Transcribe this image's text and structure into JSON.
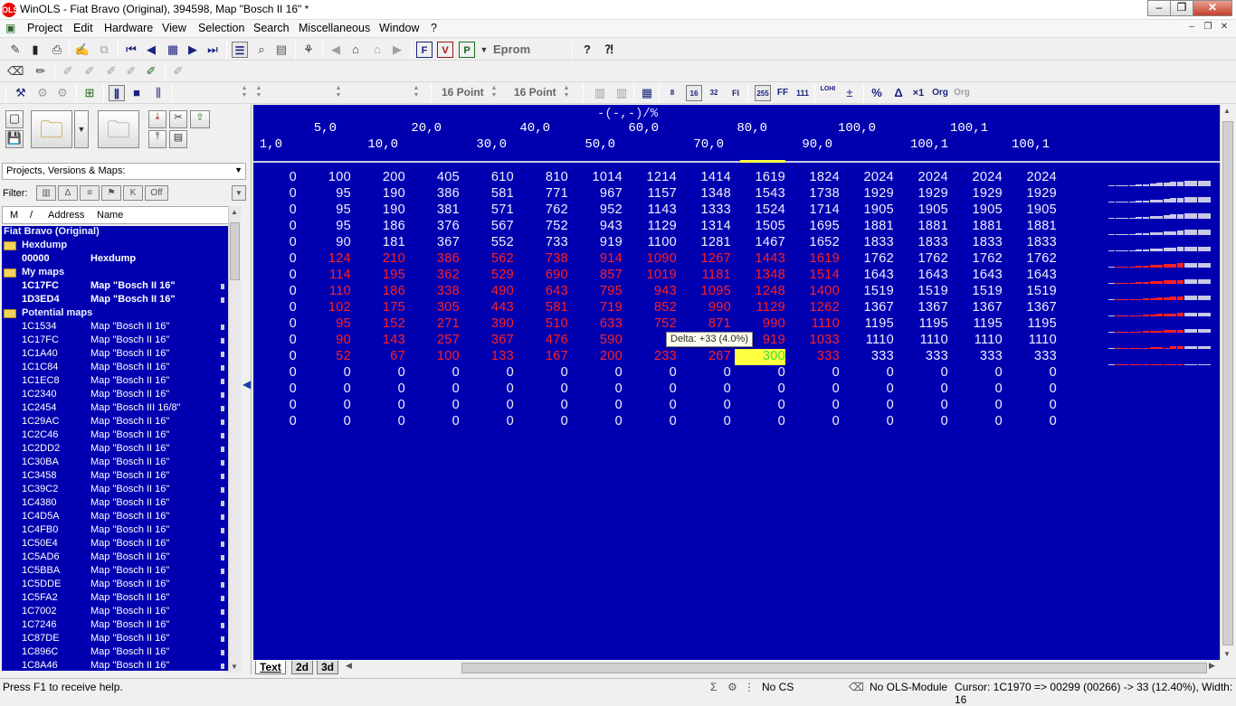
{
  "window": {
    "title": "WinOLS - Fiat Bravo (Original), 394598, Map \"Bosch II 16\" *",
    "app_icon": "winols-logo-icon"
  },
  "menu": [
    "Project",
    "Edit",
    "Hardware",
    "View",
    "Selection",
    "Search",
    "Miscellaneous",
    "Window",
    "?"
  ],
  "toolbar": {
    "eprom_label": "Eprom",
    "point_a": "16 Point",
    "point_b": "16 Point",
    "btn_255": "255",
    "btn_ff": "FF",
    "btn_111": "111",
    "btn_8": "8",
    "btn_16": "16",
    "btn_32": "32",
    "btn_fl": "Fl",
    "btn_lohi": "LOHI",
    "btn_org": "Org",
    "btn_org2": "Org",
    "btn_x1": "×1",
    "btn_pct": "%",
    "btn_delta": "Δ"
  },
  "left": {
    "combo_label": "Projects, Versions & Maps:",
    "filter_label": "Filter:",
    "filter_off": "Off",
    "col_m": "M",
    "col_slash": "/",
    "col_address": "Address",
    "col_name": "Name"
  },
  "tree": [
    {
      "type": "project",
      "text": "Fiat Bravo (Original)"
    },
    {
      "type": "group",
      "text": "Hexdump"
    },
    {
      "type": "item",
      "bold": true,
      "addr": "00000",
      "name": "Hexdump",
      "marker": false
    },
    {
      "type": "group",
      "text": "My maps"
    },
    {
      "type": "item",
      "bold": true,
      "addr": "1C17FC",
      "name": "Map \"Bosch II 16\"",
      "marker": true
    },
    {
      "type": "item",
      "bold": true,
      "addr": "1D3ED4",
      "name": "Map \"Bosch II 16\"",
      "marker": true
    },
    {
      "type": "group",
      "text": "Potential maps"
    },
    {
      "type": "item",
      "addr": "1C1534",
      "name": "Map \"Bosch II 16\"",
      "marker": true
    },
    {
      "type": "item",
      "addr": "1C17FC",
      "name": "Map \"Bosch II 16\"",
      "marker": true
    },
    {
      "type": "item",
      "addr": "1C1A40",
      "name": "Map \"Bosch II 16\"",
      "marker": true
    },
    {
      "type": "item",
      "addr": "1C1C84",
      "name": "Map \"Bosch II 16\"",
      "marker": true
    },
    {
      "type": "item",
      "addr": "1C1EC8",
      "name": "Map \"Bosch II 16\"",
      "marker": true
    },
    {
      "type": "item",
      "addr": "1C2340",
      "name": "Map \"Bosch II 16\"",
      "marker": true
    },
    {
      "type": "item",
      "addr": "1C2454",
      "name": "Map \"Bosch III 16/8\"",
      "marker": true
    },
    {
      "type": "item",
      "addr": "1C29AC",
      "name": "Map \"Bosch II 16\"",
      "marker": true
    },
    {
      "type": "item",
      "addr": "1C2C46",
      "name": "Map \"Bosch II 16\"",
      "marker": true
    },
    {
      "type": "item",
      "addr": "1C2DD2",
      "name": "Map \"Bosch II 16\"",
      "marker": true
    },
    {
      "type": "item",
      "addr": "1C30BA",
      "name": "Map \"Bosch II 16\"",
      "marker": true
    },
    {
      "type": "item",
      "addr": "1C3458",
      "name": "Map \"Bosch II 16\"",
      "marker": true
    },
    {
      "type": "item",
      "addr": "1C39C2",
      "name": "Map \"Bosch II 16\"",
      "marker": true
    },
    {
      "type": "item",
      "addr": "1C4380",
      "name": "Map \"Bosch II 16\"",
      "marker": true
    },
    {
      "type": "item",
      "addr": "1C4D5A",
      "name": "Map \"Bosch II 16\"",
      "marker": true
    },
    {
      "type": "item",
      "addr": "1C4FB0",
      "name": "Map \"Bosch II 16\"",
      "marker": true
    },
    {
      "type": "item",
      "addr": "1C50E4",
      "name": "Map \"Bosch II 16\"",
      "marker": true
    },
    {
      "type": "item",
      "addr": "1C5AD6",
      "name": "Map \"Bosch II 16\"",
      "marker": true
    },
    {
      "type": "item",
      "addr": "1C5BBA",
      "name": "Map \"Bosch II 16\"",
      "marker": true
    },
    {
      "type": "item",
      "addr": "1C5DDE",
      "name": "Map \"Bosch II 16\"",
      "marker": true
    },
    {
      "type": "item",
      "addr": "1C5FA2",
      "name": "Map \"Bosch II 16\"",
      "marker": true
    },
    {
      "type": "item",
      "addr": "1C7002",
      "name": "Map \"Bosch II 16\"",
      "marker": true
    },
    {
      "type": "item",
      "addr": "1C7246",
      "name": "Map \"Bosch II 16\"",
      "marker": true
    },
    {
      "type": "item",
      "addr": "1C87DE",
      "name": "Map \"Bosch II 16\"",
      "marker": true
    },
    {
      "type": "item",
      "addr": "1C896C",
      "name": "Map \"Bosch II 16\"",
      "marker": true
    },
    {
      "type": "item",
      "addr": "1C8A46",
      "name": "Map \"Bosch II 16\"",
      "marker": true
    }
  ],
  "map": {
    "unit": "-(-,-)/%",
    "x_top": [
      "5,0",
      "20,0",
      "40,0",
      "60,0",
      "80,0",
      "100,0",
      "100,1"
    ],
    "x_bottom": [
      "1,0",
      "10,0",
      "30,0",
      "50,0",
      "70,0",
      "90,0",
      "100,1",
      "100,1"
    ],
    "rows": [
      [
        0,
        100,
        200,
        405,
        610,
        810,
        1014,
        1214,
        1414,
        1619,
        1824,
        2024,
        2024,
        2024,
        2024
      ],
      [
        0,
        95,
        190,
        386,
        581,
        771,
        967,
        1157,
        1348,
        1543,
        1738,
        1929,
        1929,
        1929,
        1929
      ],
      [
        0,
        95,
        190,
        381,
        571,
        762,
        952,
        1143,
        1333,
        1524,
        1714,
        1905,
        1905,
        1905,
        1905
      ],
      [
        0,
        95,
        186,
        376,
        567,
        752,
        943,
        1129,
        1314,
        1505,
        1695,
        1881,
        1881,
        1881,
        1881
      ],
      [
        0,
        90,
        181,
        367,
        552,
        733,
        919,
        1100,
        1281,
        1467,
        1652,
        1833,
        1833,
        1833,
        1833
      ],
      [
        0,
        124,
        210,
        386,
        562,
        738,
        914,
        1090,
        1267,
        1443,
        1619,
        1762,
        1762,
        1762,
        1762
      ],
      [
        0,
        114,
        195,
        362,
        529,
        690,
        857,
        1019,
        1181,
        1348,
        1514,
        1643,
        1643,
        1643,
        1643
      ],
      [
        0,
        110,
        186,
        338,
        490,
        643,
        795,
        943,
        1095,
        1248,
        1400,
        1519,
        1519,
        1519,
        1519
      ],
      [
        0,
        102,
        175,
        305,
        443,
        581,
        719,
        852,
        990,
        1129,
        1262,
        1367,
        1367,
        1367,
        1367
      ],
      [
        0,
        95,
        152,
        271,
        390,
        510,
        633,
        752,
        871,
        990,
        1110,
        1195,
        1195,
        1195,
        1195
      ],
      [
        0,
        90,
        143,
        257,
        367,
        476,
        590,
        705,
        0,
        919,
        1033,
        1110,
        1110,
        1110,
        1110
      ],
      [
        0,
        52,
        67,
        100,
        133,
        167,
        200,
        233,
        267,
        300,
        333,
        333,
        333,
        333,
        333
      ],
      [
        0,
        0,
        0,
        0,
        0,
        0,
        0,
        0,
        0,
        0,
        0,
        0,
        0,
        0,
        0
      ],
      [
        0,
        0,
        0,
        0,
        0,
        0,
        0,
        0,
        0,
        0,
        0,
        0,
        0,
        0,
        0
      ],
      [
        0,
        0,
        0,
        0,
        0,
        0,
        0,
        0,
        0,
        0,
        0,
        0,
        0,
        0,
        0
      ],
      [
        0,
        0,
        0,
        0,
        0,
        0,
        0,
        0,
        0,
        0,
        0,
        0,
        0,
        0,
        0
      ]
    ],
    "hidden_cells": [
      [
        10,
        7
      ],
      [
        10,
        8
      ]
    ],
    "red_range": {
      "rows": [
        5,
        11
      ],
      "cols": [
        1,
        10
      ]
    },
    "selected": {
      "row": 11,
      "col": 9
    },
    "tooltip": "Delta: +33 (4.0%)"
  },
  "tabs": [
    "Text",
    "2d",
    "3d"
  ],
  "status": {
    "help": "Press F1 to receive help.",
    "cs": "No CS",
    "module": "No OLS-Module",
    "cursor": "Cursor: 1C1970 => 00299 (00266) -> 33 (12.40%), Width: 16"
  },
  "colors": {
    "map_bg": "#0000b0",
    "red_value": "#ff2020",
    "selected_bg": "#ffff40",
    "selected_fg": "#40e040",
    "list_bg": "#0000b0"
  }
}
